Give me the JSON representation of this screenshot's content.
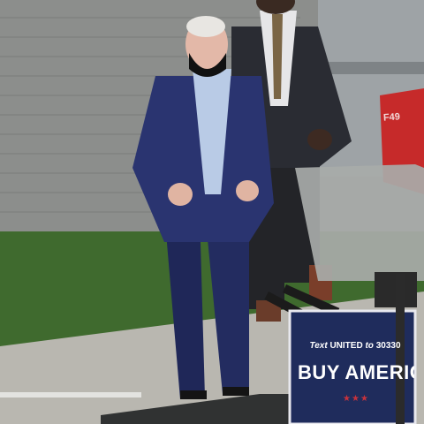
{
  "sign": {
    "text_prefix": "Text",
    "text_keyword": "UNITED",
    "text_to": "to",
    "text_number": "30330",
    "slogan": "BUY AMERICA",
    "stars": "★★★"
  },
  "truck": {
    "label": "F49"
  },
  "colors": {
    "wall": "#8c8e8c",
    "grass": "#3f6a2e",
    "sidewalk": "#b9b7b0",
    "suit_blue": "#2a3470",
    "dark_suit": "#232428",
    "sign_navy": "#1f2c5c",
    "truck_red": "#c62a2a"
  }
}
